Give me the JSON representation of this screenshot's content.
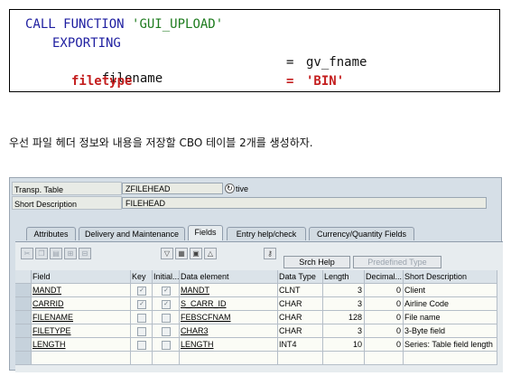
{
  "code": {
    "line1_kw": "CALL FUNCTION",
    "line1_str": "'GUI_UPLOAD'",
    "line2": "EXPORTING",
    "line3_param": "filename",
    "line3_eq": "=",
    "line3_val": "gv_fname",
    "line4_param": "filetype",
    "line4_eq": "=",
    "line4_val": "'BIN'"
  },
  "sentence": "우선 파일 헤더 정보와 내용을 저장할 CBO 테이블 2개를 생성하자.",
  "sap": {
    "transp_table_label": "Transp. Table",
    "transp_table_value": "ZFILEHEAD",
    "status_text": "tive",
    "short_desc_label": "Short Description",
    "short_desc_value": "FILEHEAD",
    "tabs": [
      "Attributes",
      "Delivery and Maintenance",
      "Fields",
      "Entry help/check",
      "Currency/Quantity Fields"
    ],
    "active_tab": "Fields",
    "toolbar": {
      "srch_help": "Srch Help",
      "predefined_type": "Predefined Type"
    },
    "columns": [
      "Field",
      "Key",
      "Initial...",
      "Data element",
      "Data Type",
      "Length",
      "Decimal...",
      "Short Description"
    ],
    "rows": [
      {
        "field": "MANDT",
        "key": true,
        "initial": true,
        "data_element": "MANDT",
        "data_type": "CLNT",
        "length": "3",
        "decimal": "0",
        "desc": "Client"
      },
      {
        "field": "CARRID",
        "key": true,
        "initial": true,
        "data_element": "S_CARR_ID",
        "data_type": "CHAR",
        "length": "3",
        "decimal": "0",
        "desc": "Airline Code"
      },
      {
        "field": "FILENAME",
        "key": false,
        "initial": false,
        "data_element": "FEBSCFNAM",
        "data_type": "CHAR",
        "length": "128",
        "decimal": "0",
        "desc": "File name"
      },
      {
        "field": "FILETYPE",
        "key": false,
        "initial": false,
        "data_element": "CHAR3",
        "data_type": "CHAR",
        "length": "3",
        "decimal": "0",
        "desc": "3-Byte field"
      },
      {
        "field": "LENGTH",
        "key": false,
        "initial": false,
        "data_element": "LENGTH",
        "data_type": "INT4",
        "length": "10",
        "decimal": "0",
        "desc": "Series: Table field length"
      }
    ]
  }
}
